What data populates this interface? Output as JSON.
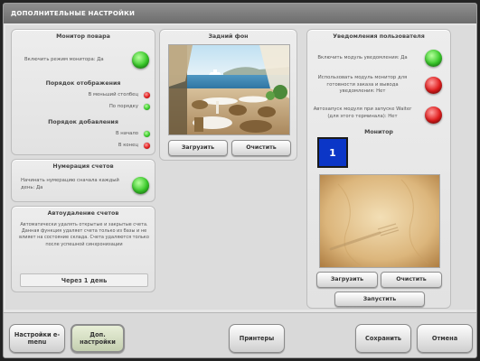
{
  "window": {
    "title": "ДОПОЛНИТЕЛЬНЫЕ НАСТРОЙКИ"
  },
  "cook_monitor": {
    "header": "Монитор повара",
    "enable_label": "Включить режим монитора: Да",
    "enable_status": "green",
    "display_order": {
      "header": "Порядок отображения",
      "items": [
        {
          "label": "В меньший столбец",
          "status": "red"
        },
        {
          "label": "По порядку",
          "status": "green"
        }
      ]
    },
    "add_order": {
      "header": "Порядок добавления",
      "items": [
        {
          "label": "В начало",
          "status": "green"
        },
        {
          "label": "В конец",
          "status": "red"
        }
      ]
    }
  },
  "bill_numbering": {
    "header": "Нумерация счетов",
    "label": "Начинать нумерацию сначала каждый день: Да",
    "status": "green"
  },
  "auto_delete": {
    "header": "Автоудаление счетов",
    "description": "Автоматически удалять открытые и закрытые счета. Данная функция удаляет счета только из базы и не влияет на состояние склада. Счета удаляются только после успешной синхронизации",
    "value": "Через 1 день"
  },
  "background": {
    "header": "Задний фон",
    "load_label": "Загрузить",
    "clear_label": "Очистить"
  },
  "notifications": {
    "header": "Уведомления пользователя",
    "items": [
      {
        "label": "Включить модуль уведомления: Да",
        "status": "green"
      },
      {
        "label": "Использовать модуль монитор для готовности заказа и вывода уведомления: Нет",
        "status": "red"
      },
      {
        "label": "Автозапуск модуля при запуске Waiter (для этого терминала): Нет",
        "status": "red"
      }
    ],
    "monitor_header": "Монитор",
    "monitor_number": "1",
    "load_label": "Загрузить",
    "clear_label": "Очистить",
    "launch_label": "Запустить"
  },
  "bottom": {
    "emenu_label": "Настройки e-menu",
    "extra_label": "Доп. настройки",
    "printers_label": "Принтеры",
    "save_label": "Сохранить",
    "cancel_label": "Отмена"
  },
  "colors": {
    "led_green": "#39c92a",
    "led_red": "#e01c1c",
    "monitor_blue": "#0b36c7",
    "title_bar": "#7d7d7d"
  }
}
